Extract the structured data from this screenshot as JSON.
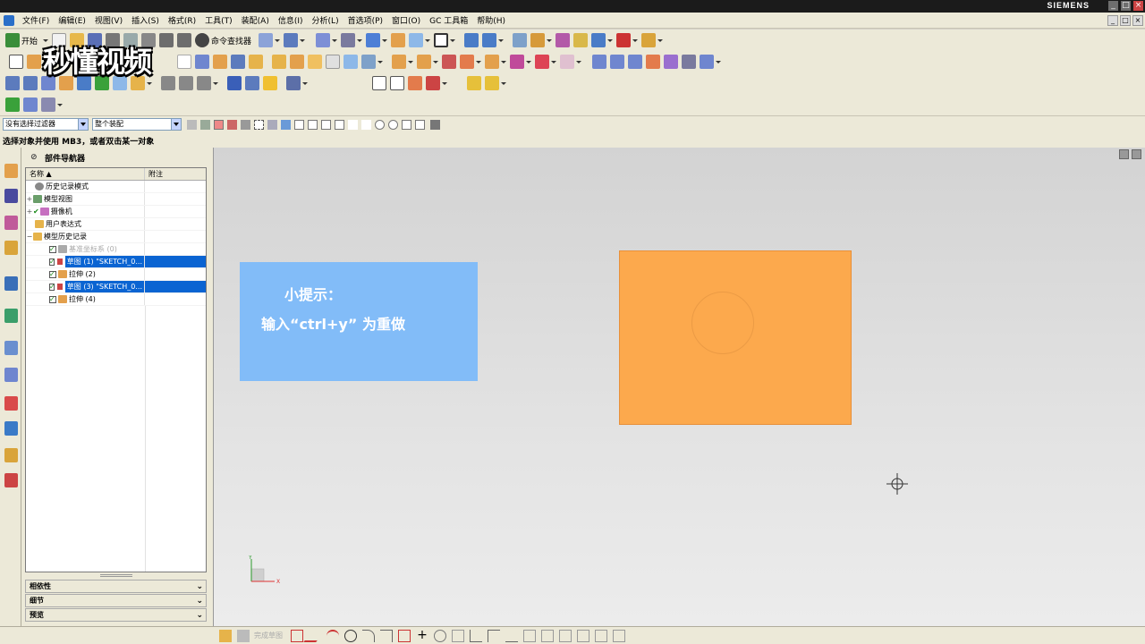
{
  "window": {
    "brand": "SIEMENS",
    "controls": [
      "_",
      "□",
      "×"
    ]
  },
  "menubar": {
    "items": [
      "文件(F)",
      "编辑(E)",
      "视图(V)",
      "插入(S)",
      "格式(R)",
      "工具(T)",
      "装配(A)",
      "信息(I)",
      "分析(L)",
      "首选项(P)",
      "窗口(O)",
      "GC 工具箱",
      "帮助(H)"
    ]
  },
  "toolbar": {
    "start_label": "开始",
    "command_finder_label": "命令查找器"
  },
  "watermark": {
    "text": "秒懂视频"
  },
  "filterbar": {
    "selection_filter": "没有选择过滤器",
    "assembly_scope": "整个装配"
  },
  "status": {
    "prompt": "选择对象并使用 MB3，或者双击某一对象"
  },
  "part_navigator": {
    "title": "部件导航器",
    "columns": [
      "名称",
      "附注"
    ],
    "rows": [
      {
        "label": "历史记录模式",
        "selected": false,
        "dim": false
      },
      {
        "label": "模型视图",
        "selected": false,
        "dim": false
      },
      {
        "label": "摄像机",
        "selected": false,
        "dim": false
      },
      {
        "label": "用户表达式",
        "selected": false,
        "dim": false
      },
      {
        "label": "模型历史记录",
        "selected": false,
        "dim": false
      },
      {
        "label": "基准坐标系 (0)",
        "selected": false,
        "dim": true
      },
      {
        "label": "草图 (1) \"SKETCH_0...",
        "selected": true,
        "dim": false
      },
      {
        "label": "拉伸 (2)",
        "selected": false,
        "dim": false
      },
      {
        "label": "草图 (3) \"SKETCH_0...",
        "selected": true,
        "dim": false
      },
      {
        "label": "拉伸 (4)",
        "selected": false,
        "dim": false
      }
    ],
    "sections": [
      "相依性",
      "细节",
      "预览"
    ]
  },
  "viewport": {
    "tip_title": "小提示：",
    "tip_body": "输入“ctrl+y” 为重做",
    "wcs_y": "Y",
    "wcs_x": "X"
  },
  "sketch_bar": {
    "finish_label": "完成草图"
  },
  "colors": {
    "selection": "#0a64d2",
    "tip_background": "#82bcf8",
    "extrude_face": "#fca94d"
  }
}
